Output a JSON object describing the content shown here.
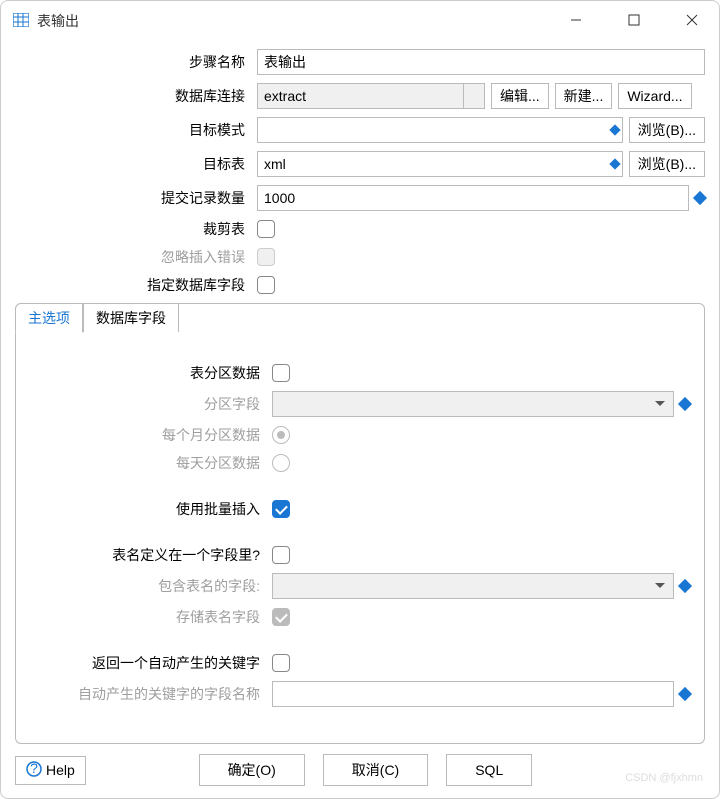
{
  "window": {
    "title": "表输出"
  },
  "form": {
    "step_name_label": "步骤名称",
    "step_name_value": "表输出",
    "db_conn_label": "数据库连接",
    "db_conn_value": "extract",
    "db_btn_edit": "编辑...",
    "db_btn_new": "新建...",
    "db_btn_wizard": "Wizard...",
    "target_schema_label": "目标模式",
    "target_schema_value": "",
    "browse_b": "浏览(B)...",
    "target_table_label": "目标表",
    "target_table_value": "xml",
    "commit_size_label": "提交记录数量",
    "commit_size_value": "1000",
    "truncate_label": "裁剪表",
    "ignore_err_label": "忽略插入错误",
    "specify_fields_label": "指定数据库字段"
  },
  "tabs": {
    "main": "主选项",
    "fields": "数据库字段"
  },
  "main_tab": {
    "partition_data_label": "表分区数据",
    "partition_field_label": "分区字段",
    "monthly_label": "每个月分区数据",
    "daily_label": "每天分区数据",
    "batch_insert_label": "使用批量插入",
    "tablename_in_field_label": "表名定义在一个字段里?",
    "fieldname_contains_table_label": "包含表名的字段:",
    "store_tablename_label": "存储表名字段",
    "return_keys_label": "返回一个自动产生的关键字",
    "autokeys_fieldname_label": "自动产生的关键字的字段名称",
    "autokeys_fieldname_value": ""
  },
  "footer": {
    "help": "Help",
    "ok": "确定(O)",
    "cancel": "取消(C)",
    "sql": "SQL"
  },
  "watermark": "CSDN @fjxhmn"
}
